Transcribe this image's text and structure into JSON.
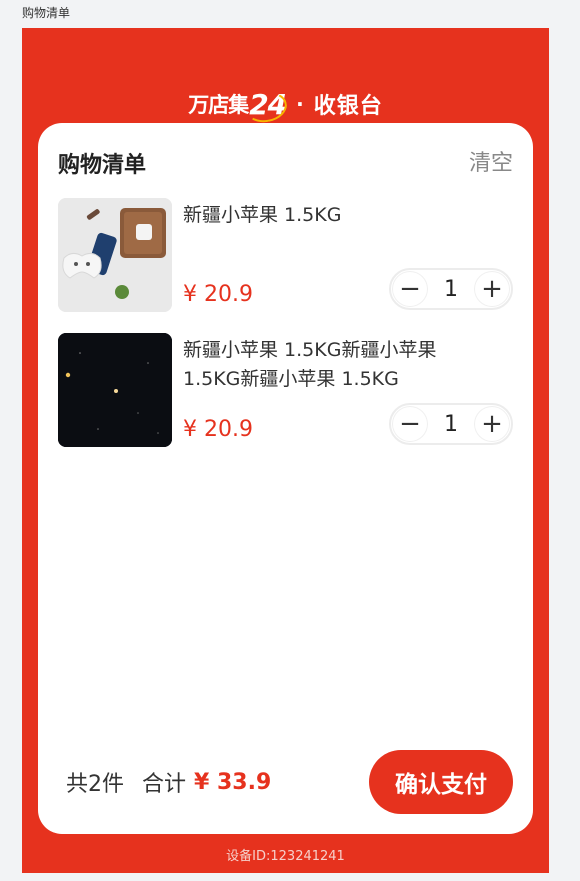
{
  "page_label": "购物清单",
  "brand": {
    "logo_text": "万店集",
    "logo_num": "24",
    "separator": "·",
    "title": "收银台"
  },
  "cart": {
    "title": "购物清单",
    "clear_label": "清空",
    "items": [
      {
        "name": "新疆小苹果 1.5KG",
        "price": "¥ 20.9",
        "quantity": "1",
        "minus": "−",
        "plus": "+"
      },
      {
        "name": "新疆小苹果 1.5KG新疆小苹果 1.5KG新疆小苹果 1.5KG",
        "price": "¥ 20.9",
        "quantity": "1",
        "minus": "−",
        "plus": "+"
      }
    ]
  },
  "footer": {
    "count_label": "共2件",
    "total_label": "合计",
    "total_price": "¥ 33.9",
    "pay_label": "确认支付"
  },
  "device_id": "设备ID:123241241",
  "colors": {
    "brand_red": "#e6321e",
    "ring_yellow": "#f7b500"
  }
}
